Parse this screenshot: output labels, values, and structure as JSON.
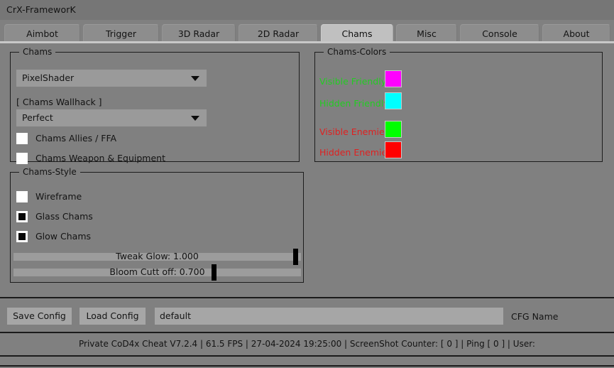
{
  "window": {
    "title": "CrX-FrameworK"
  },
  "tabs": [
    {
      "label": "Aimbot",
      "active": false
    },
    {
      "label": "Trigger",
      "active": false
    },
    {
      "label": "3D Radar",
      "active": false
    },
    {
      "label": "2D Radar",
      "active": false
    },
    {
      "label": "Chams",
      "active": true
    },
    {
      "label": "Misc",
      "active": false
    },
    {
      "label": "Console",
      "active": false
    },
    {
      "label": "About",
      "active": false
    }
  ],
  "chams_group": {
    "title": "Chams",
    "shader_combo": {
      "value": "PixelShader",
      "arrow_icon": "chevron-down-icon"
    },
    "wallhack_label": "[ Chams Wallhack ]",
    "wallhack_combo": {
      "value": "Perfect",
      "arrow_icon": "chevron-down-icon"
    },
    "checkboxes": [
      {
        "label": "Chams Allies / FFA",
        "checked": false
      },
      {
        "label": "Chams Weapon & Equipment",
        "checked": false
      }
    ]
  },
  "chams_colors_group": {
    "title": "Chams-Colors",
    "rows": [
      {
        "label": "Visible Friendly",
        "label_color": "#22cc22",
        "swatch_color": "#ff00ff"
      },
      {
        "label": "Hidden Friendly",
        "label_color": "#22cc22",
        "swatch_color": "#00ffff"
      },
      {
        "label": "Visible Enemies",
        "label_color": "#e02020",
        "swatch_color": "#00ff00"
      },
      {
        "label": "Hidden Enemies",
        "label_color": "#e02020",
        "swatch_color": "#ff0000"
      }
    ]
  },
  "chams_style_group": {
    "title": "Chams-Style",
    "checkboxes": [
      {
        "label": "Wireframe",
        "checked": false
      },
      {
        "label": "Glass Chams",
        "checked": true
      },
      {
        "label": "Glow Chams",
        "checked": true
      }
    ],
    "sliders": [
      {
        "caption": "Tweak Glow: 1.000",
        "value": 1.0,
        "min": 0,
        "max": 1,
        "percent": 97.5
      },
      {
        "caption": "Bloom Cutt off: 0.700",
        "value": 0.7,
        "min": 0,
        "max": 1,
        "percent": 69.0
      }
    ]
  },
  "bottom": {
    "save_button": "Save Config",
    "load_button": "Load Config",
    "cfg_value": "default",
    "cfg_placeholder": "default",
    "cfg_name_label": "CFG Name"
  },
  "status": {
    "text": "Private CoD4x Cheat V7.2.4  | 61.5 FPS |  27-04-2024 19:25:00  | ScreenShot Counter: [ 0 ] | Ping [ 0 ] | User:"
  }
}
